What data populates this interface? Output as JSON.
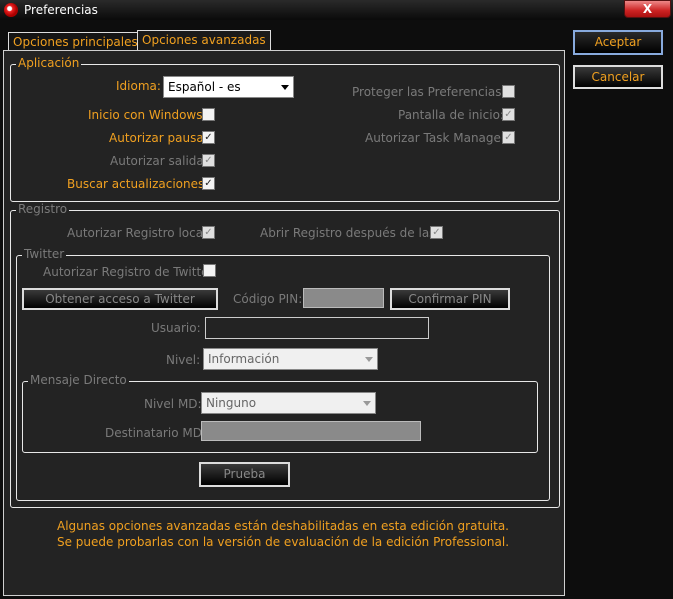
{
  "window": {
    "title": "Preferencias",
    "close": "X"
  },
  "tabs": [
    {
      "label": "Opciones principales"
    },
    {
      "label": "Opciones avanzadas"
    }
  ],
  "buttons": {
    "ok": "Aceptar",
    "cancel": "Cancelar"
  },
  "aplicacion": {
    "legend": "Aplicación",
    "idioma_label": "Idioma:",
    "idioma_value": "Español - es",
    "inicio_windows": "Inicio con Windows:",
    "autorizar_pausa": "Autorizar pausa:",
    "autorizar_salida": "Autorizar salida:",
    "buscar_actualizaciones": "Buscar actualizaciones:",
    "proteger": "Proteger las Preferencias:",
    "pantalla_inicio": "Pantalla de inicio:",
    "task_manager": "Autorizar Task Manager:",
    "checks": {
      "inicio_windows": false,
      "autorizar_pausa": true,
      "autorizar_salida": true,
      "buscar_actualizaciones": true,
      "proteger": false,
      "pantalla_inicio": true,
      "task_manager": true
    }
  },
  "registro": {
    "legend": "Registro",
    "local": "Autorizar Registro local:",
    "abrir": "Abrir Registro después de las:",
    "twitter": {
      "legend": "Twitter",
      "autorizar": "Autorizar Registro de Twitter:",
      "obtener": "Obtener acceso a Twitter",
      "pin_label": "Código PIN:",
      "confirmar": "Confirmar PIN",
      "usuario": "Usuario:",
      "nivel": "Nivel:",
      "nivel_value": "Información",
      "md": {
        "legend": "Mensaje Directo",
        "nivel": "Nivel MD:",
        "nivel_value": "Ninguno",
        "destinatario": "Destinatario MD:"
      },
      "prueba": "Prueba"
    }
  },
  "footer": {
    "line1": "Algunas opciones avanzadas están deshabilitadas en esta edición gratuita.",
    "line2": "Se puede probarlas con la versión de evaluación de la edición Professional."
  },
  "check_mark": "✓"
}
